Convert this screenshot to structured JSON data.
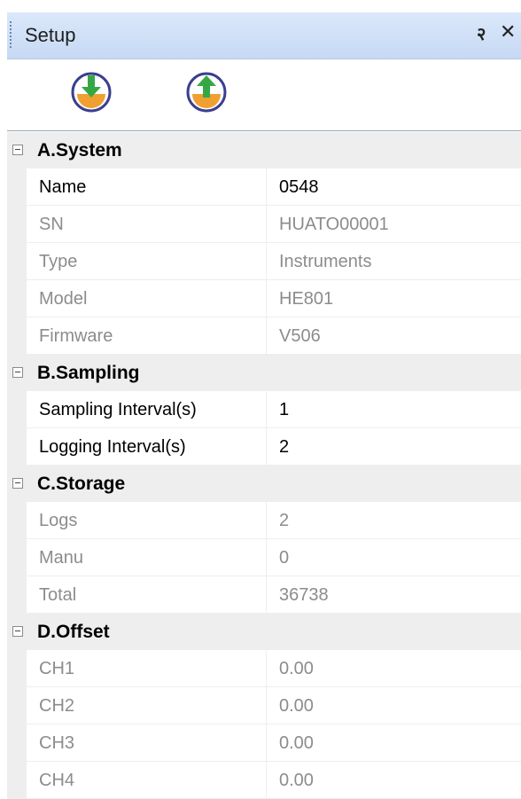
{
  "panel": {
    "title": "Setup",
    "pin_glyph": "२",
    "close_glyph": "✕"
  },
  "toolbar": {
    "buttons": [
      {
        "icon": "download-icon",
        "color": "#3aa84a"
      },
      {
        "icon": "upload-icon",
        "color": "#3aa84a"
      }
    ]
  },
  "colors": {
    "accent_ring": "#3b3f8f",
    "orange": "#f0a030",
    "green_arrow": "#35a845",
    "category_bg": "#eeeeee",
    "title_bg": "#c6d9f4"
  },
  "categories": [
    {
      "label": "A.System",
      "rows": [
        {
          "name": "Name",
          "value": "0548",
          "readonly": false
        },
        {
          "name": "SN",
          "value": "HUATO00001",
          "readonly": true
        },
        {
          "name": "Type",
          "value": "Instruments",
          "readonly": true
        },
        {
          "name": "Model",
          "value": "HE801",
          "readonly": true
        },
        {
          "name": "Firmware",
          "value": "V506",
          "readonly": true
        }
      ]
    },
    {
      "label": "B.Sampling",
      "rows": [
        {
          "name": "Sampling Interval(s)",
          "value": "1",
          "readonly": false
        },
        {
          "name": "Logging Interval(s)",
          "value": "2",
          "readonly": false
        }
      ]
    },
    {
      "label": "C.Storage",
      "rows": [
        {
          "name": "Logs",
          "value": "2",
          "readonly": true
        },
        {
          "name": "Manu",
          "value": "0",
          "readonly": true
        },
        {
          "name": "Total",
          "value": "36738",
          "readonly": true
        }
      ]
    },
    {
      "label": "D.Offset",
      "rows": [
        {
          "name": "CH1",
          "value": "0.00",
          "readonly": true
        },
        {
          "name": "CH2",
          "value": "0.00",
          "readonly": true
        },
        {
          "name": "CH3",
          "value": "0.00",
          "readonly": true
        },
        {
          "name": "CH4",
          "value": "0.00",
          "readonly": true
        }
      ]
    }
  ]
}
